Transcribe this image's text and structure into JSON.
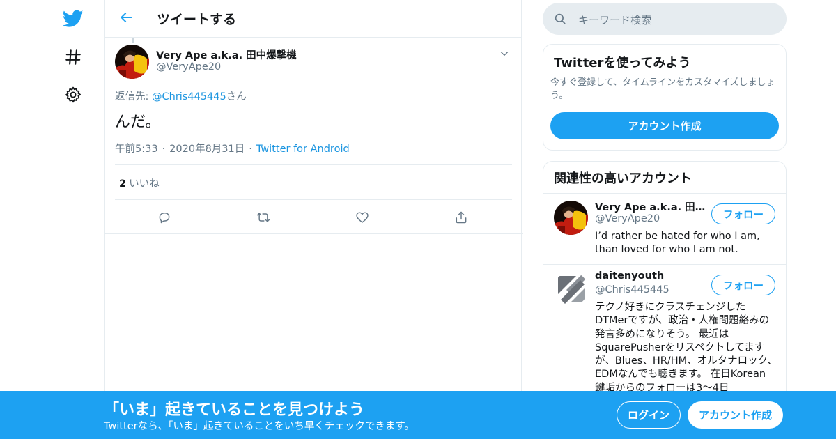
{
  "colors": {
    "accent": "#1da1f2",
    "link": "#1b95e0",
    "text": "#14171a",
    "muted": "#657786",
    "border": "#e6ecf0",
    "search_bg": "#e6ecf0"
  },
  "nav": {
    "items": [
      {
        "icon": "twitter-bird-icon"
      },
      {
        "icon": "hashtag-icon"
      },
      {
        "icon": "gear-icon"
      }
    ]
  },
  "header": {
    "back_icon": "arrow-left-icon",
    "title": "ツイートする"
  },
  "tweet": {
    "author_name": "Very Ape a.k.a. 田中爆撃機",
    "author_handle": "@VeryApe20",
    "reply_prefix": "返信先: ",
    "reply_handle": "@Chris445445",
    "reply_suffix": "さん",
    "text": "んだ。",
    "time": "午前5:33",
    "separator": "·",
    "date": "2020年8月31日",
    "client": "Twitter for Android",
    "like_count": "2",
    "like_label": "いいね",
    "actions": [
      {
        "icon": "reply-icon"
      },
      {
        "icon": "retweet-icon"
      },
      {
        "icon": "heart-icon"
      },
      {
        "icon": "share-icon"
      }
    ]
  },
  "search": {
    "placeholder": "キーワード検索"
  },
  "signup_card": {
    "title": "Twitterを使ってみよう",
    "description": "今すぐ登録して、タイムラインをカスタマイズしましょう。",
    "button": "アカウント作成"
  },
  "related": {
    "title": "関連性の高いアカウント",
    "users": [
      {
        "name": "Very Ape a.k.a. 田中爆撃機",
        "handle": "@VeryApe20",
        "follow_label": "フォロー",
        "bio": "I’d rather be hated for who I am, than loved for who I am not."
      },
      {
        "name": "daitenyouth",
        "handle": "@Chris445445",
        "follow_label": "フォロー",
        "bio": "テクノ好きにクラスチェンジしたDTMerですが、政治・人権問題絡みの発言多めになりそう。 最近はSquarePusherをリスペクトしてますが、Blues、HR/HM、オルタナロック、EDMなんでも聴きます。 在日Korean 鍵垢からのフォローは3～4日"
      }
    ]
  },
  "banner": {
    "title": "「いま」起きていることを見つけよう",
    "subtitle": "Twitterなら、「いま」起きていることをいち早くチェックできます。",
    "login": "ログイン",
    "signup": "アカウント作成"
  }
}
